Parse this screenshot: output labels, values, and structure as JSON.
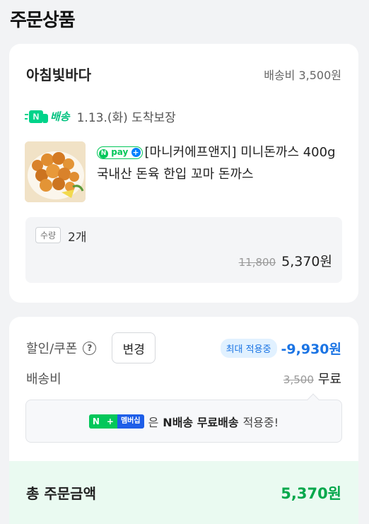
{
  "section_title": "주문상품",
  "order": {
    "seller_name": "아침빛바다",
    "shipping_fee": "배송비 3,500원",
    "delivery_badge": "배송",
    "delivery_badge_n": "N",
    "arrival": "1.13.(화) 도착보장",
    "product": {
      "npay_n": "N",
      "npay_text": "pay",
      "npay_plus": "+",
      "name": "[마니커에프앤지] 미니돈까스 400g 국내산 돈육 한입 꼬마 돈까스"
    },
    "quantity_tag": "수량",
    "quantity_value": "2개",
    "original_price": "11,800",
    "price": "5,370원"
  },
  "summary": {
    "discount_label": "할인/쿠폰",
    "help_icon_glyph": "?",
    "change_button": "변경",
    "max_badge": "최대 적용중",
    "discount_amount": "-9,930원",
    "shipping_label": "배송비",
    "shipping_original": "3,500",
    "shipping_value": "무료",
    "member_badge_n": "N",
    "member_badge_plus": "+",
    "member_badge_text": "멤버십",
    "member_msg_prefix": "은",
    "member_msg_bold": "N배송 무료배송",
    "member_msg_suffix": "적용중!",
    "total_label": "총 주문금액",
    "total_amount": "5,370원"
  },
  "colors": {
    "accent_green": "#05a84c",
    "discount_blue": "#1b74e4",
    "naver_green": "#03c75a"
  }
}
